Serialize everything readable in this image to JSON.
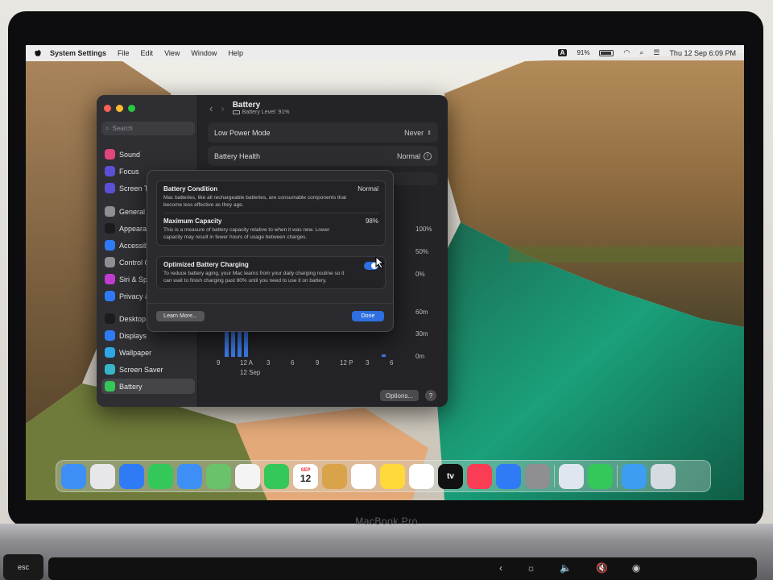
{
  "menubar": {
    "app_name": "System Settings",
    "menus": [
      "File",
      "Edit",
      "View",
      "Window",
      "Help"
    ],
    "input_badge": "A",
    "battery_percent": "91%",
    "datetime": "Thu 12 Sep  6:09 PM"
  },
  "settings": {
    "search_placeholder": "Search",
    "sidebar_items": [
      {
        "label": "Sound",
        "icon": "speaker-icon",
        "color": "#e0457b"
      },
      {
        "label": "Focus",
        "icon": "moon-icon",
        "color": "#5b4fd6"
      },
      {
        "label": "Screen T",
        "icon": "hourglass-icon",
        "color": "#5b4fd6"
      },
      {
        "label": "General",
        "icon": "gear-icon",
        "color": "#8e8e93"
      },
      {
        "label": "Appearan",
        "icon": "appearance-icon",
        "color": "#1c1c1e"
      },
      {
        "label": "Accessib",
        "icon": "accessibility-icon",
        "color": "#2f7bf5"
      },
      {
        "label": "Control C",
        "icon": "control-center-icon",
        "color": "#8e8e93"
      },
      {
        "label": "Siri & Sp",
        "icon": "siri-icon",
        "color": "#c03bd0"
      },
      {
        "label": "Privacy &",
        "icon": "hand-icon",
        "color": "#2f7bf5"
      },
      {
        "label": "Desktop",
        "icon": "desktop-icon",
        "color": "#1c1c1e"
      },
      {
        "label": "Displays",
        "icon": "display-icon",
        "color": "#2f7bf5"
      },
      {
        "label": "Wallpaper",
        "icon": "wallpaper-icon",
        "color": "#2fa6e6"
      },
      {
        "label": "Screen Saver",
        "icon": "screensaver-icon",
        "color": "#38b6c9"
      },
      {
        "label": "Battery",
        "icon": "battery-icon",
        "color": "#34c759"
      }
    ],
    "page_title": "Battery",
    "page_subtitle": "Battery Level: 91%",
    "low_power_label": "Low Power Mode",
    "low_power_value": "Never",
    "battery_health_label": "Battery Health",
    "battery_health_value": "Normal",
    "chart": {
      "y_labels_level": [
        "100%",
        "50%",
        "0%"
      ],
      "y_labels_usage": [
        "60m",
        "30m",
        "0m"
      ],
      "x_labels": [
        "9",
        "12 A",
        "3",
        "6",
        "9",
        "12 P",
        "3",
        "6"
      ],
      "date_label": "12 Sep"
    },
    "options_button": "Options...",
    "help_button": "?"
  },
  "dialog": {
    "condition_title": "Battery Condition",
    "condition_value": "Normal",
    "condition_desc": "Mac batteries, like all rechargeable batteries, are consumable components that become less effective as they age.",
    "capacity_title": "Maximum Capacity",
    "capacity_value": "98%",
    "capacity_desc": "This is a measure of battery capacity relative to when it was new. Lower capacity may result in fewer hours of usage between charges.",
    "optimized_title": "Optimized Battery Charging",
    "optimized_desc": "To reduce battery aging, your Mac learns from your daily charging routine so it can wait to finish charging past 80% until you need to use it on battery.",
    "optimized_enabled": true,
    "learn_more": "Learn More...",
    "done": "Done"
  },
  "dock": {
    "apps": [
      {
        "name": "finder-icon",
        "color": "#3d8ff5"
      },
      {
        "name": "launchpad-icon",
        "color": "#e7e7ea"
      },
      {
        "name": "safari-icon",
        "color": "#2f7bf5"
      },
      {
        "name": "messages-icon",
        "color": "#34c759"
      },
      {
        "name": "mail-icon",
        "color": "#3d8ff5"
      },
      {
        "name": "maps-icon",
        "color": "#6ac26a"
      },
      {
        "name": "photos-icon",
        "color": "#f4f4f4"
      },
      {
        "name": "facetime-icon",
        "color": "#34c759"
      },
      {
        "name": "calendar-icon",
        "color": "#ffffff"
      },
      {
        "name": "contacts-icon",
        "color": "#d9a34a"
      },
      {
        "name": "reminders-icon",
        "color": "#ffffff"
      },
      {
        "name": "notes-icon",
        "color": "#ffd83a"
      },
      {
        "name": "freeform-icon",
        "color": "#ffffff"
      },
      {
        "name": "appletv-icon",
        "color": "#111111"
      },
      {
        "name": "music-icon",
        "color": "#fa3c55"
      },
      {
        "name": "appstore-icon",
        "color": "#2f7bf5"
      },
      {
        "name": "system-settings-icon",
        "color": "#8e8e93"
      },
      {
        "name": "preview-icon",
        "color": "#dfe6ef"
      },
      {
        "name": "find-my-icon",
        "color": "#34c759"
      },
      {
        "name": "downloads-folder-icon",
        "color": "#3d9df0"
      },
      {
        "name": "trash-icon",
        "color": "#d5dbe0"
      }
    ],
    "calendar_month": "SEP",
    "calendar_day": "12",
    "appletv_label": "tv"
  },
  "hardware": {
    "brand": "MacBook Pro",
    "esc": "esc"
  }
}
